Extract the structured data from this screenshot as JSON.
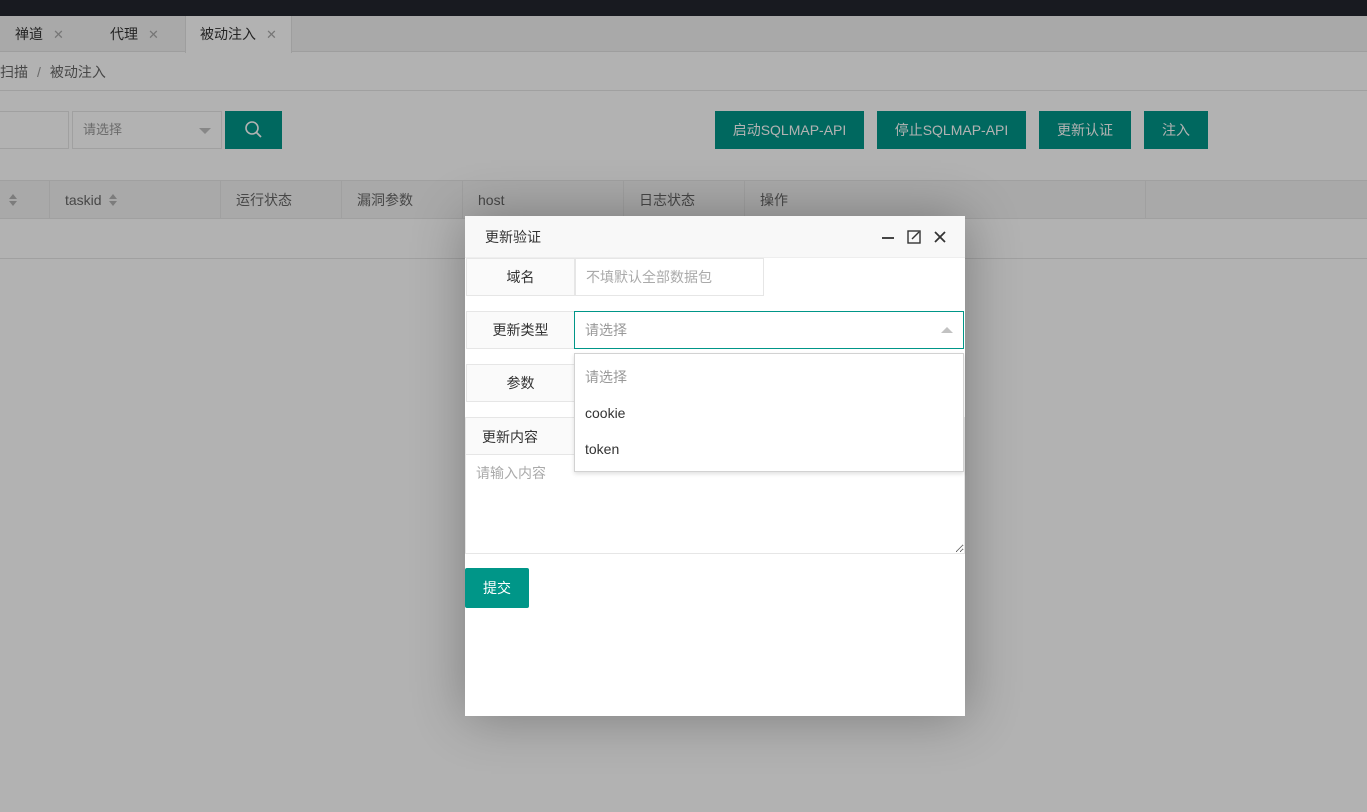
{
  "tabs": [
    {
      "label": "禅道",
      "close": "✕"
    },
    {
      "label": "代理",
      "close": "✕"
    },
    {
      "label": "被动注入",
      "close": "✕"
    }
  ],
  "breadcrumb": {
    "items": [
      "扫描",
      "被动注入"
    ],
    "separator": "/"
  },
  "toolbar": {
    "filter_placeholder": "请选择",
    "buttons": {
      "start_api": "启动SQLMAP-API",
      "stop_api": "停止SQLMAP-API",
      "update_auth": "更新认证",
      "inject": "注入"
    }
  },
  "table": {
    "columns": [
      "taskid",
      "运行状态",
      "漏洞参数",
      "host",
      "日志状态",
      "操作"
    ]
  },
  "modal": {
    "title": "更新验证",
    "fields": {
      "domain_label": "域名",
      "domain_placeholder": "不填默认全部数据包",
      "type_label": "更新类型",
      "type_placeholder": "请选择",
      "param_label": "参数",
      "content_label": "更新内容",
      "content_placeholder": "请输入内容"
    },
    "dropdown_options": [
      "请选择",
      "cookie",
      "token"
    ],
    "submit_label": "提交"
  },
  "colors": {
    "accent": "#009688",
    "topbar": "#23262e"
  }
}
